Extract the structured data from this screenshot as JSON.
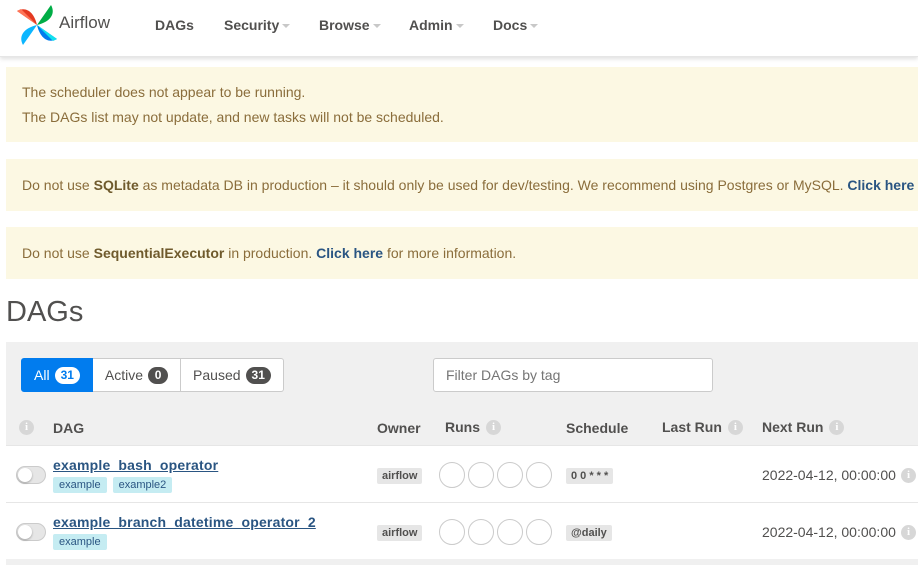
{
  "navbar": {
    "brand": "Airflow",
    "items": [
      {
        "label": "DAGs",
        "dropdown": false
      },
      {
        "label": "Security",
        "dropdown": true
      },
      {
        "label": "Browse",
        "dropdown": true
      },
      {
        "label": "Admin",
        "dropdown": true
      },
      {
        "label": "Docs",
        "dropdown": true
      }
    ]
  },
  "alerts": {
    "scheduler": {
      "line1": "The scheduler does not appear to be running.",
      "line2": "The DAGs list may not update, and new tasks will not be scheduled."
    },
    "sqlite": {
      "pre": "Do not use ",
      "strong": "SQLite",
      "mid": " as metadata DB in production – it should only be used for dev/testing. We recommend using Postgres or MySQL. ",
      "link": "Click here"
    },
    "executor": {
      "pre": "Do not use ",
      "strong": "SequentialExecutor",
      "mid": " in production. ",
      "link": "Click here",
      "post": " for more information."
    }
  },
  "page_title": "DAGs",
  "filters": {
    "all": {
      "label": "All",
      "count": "31"
    },
    "active": {
      "label": "Active",
      "count": "0"
    },
    "paused": {
      "label": "Paused",
      "count": "31"
    },
    "tag_placeholder": "Filter DAGs by tag"
  },
  "table": {
    "headers": {
      "info": "i",
      "dag": "DAG",
      "owner": "Owner",
      "runs": "Runs",
      "schedule": "Schedule",
      "last_run": "Last Run",
      "next_run": "Next Run"
    },
    "rows": [
      {
        "dag_id": "example_bash_operator",
        "tags": [
          "example",
          "example2"
        ],
        "owner": "airflow",
        "schedule": "0 0 * * *",
        "next_run": "2022-04-12, 00:00:00"
      },
      {
        "dag_id": "example_branch_datetime_operator_2",
        "tags": [
          "example"
        ],
        "owner": "airflow",
        "schedule": "@daily",
        "next_run": "2022-04-12, 00:00:00"
      }
    ]
  },
  "colors": {
    "primary": "#017cee",
    "alert_bg": "#fcf8e3",
    "link": "#2a5582",
    "tag_bg": "#c5ecf2"
  }
}
